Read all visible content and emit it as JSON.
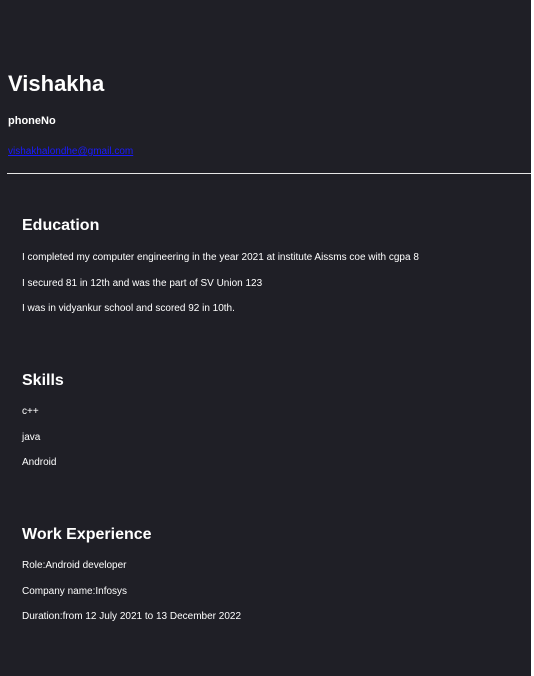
{
  "profile": {
    "name": "Vishakha",
    "phone": "phoneNo",
    "email": "vishakhalondhe@gmail.com"
  },
  "education": {
    "title": "Education",
    "items": [
      "I completed my computer engineering in the year 2021 at institute Aissms coe with cgpa 8",
      "I secured 81 in 12th and was the part of SV Union 123",
      "I was in vidyankur school and scored 92 in 10th."
    ]
  },
  "skills": {
    "title": "Skills",
    "items": [
      "c++",
      "java",
      "Android"
    ]
  },
  "work": {
    "title": "Work Experience",
    "items": [
      "Role:Android developer",
      "Company name:Infosys",
      "Duration:from 12 July 2021 to 13 December 2022"
    ]
  },
  "colors": {
    "background": "#1f1f26",
    "link": "#1a1aff",
    "text": "#ffffff"
  }
}
